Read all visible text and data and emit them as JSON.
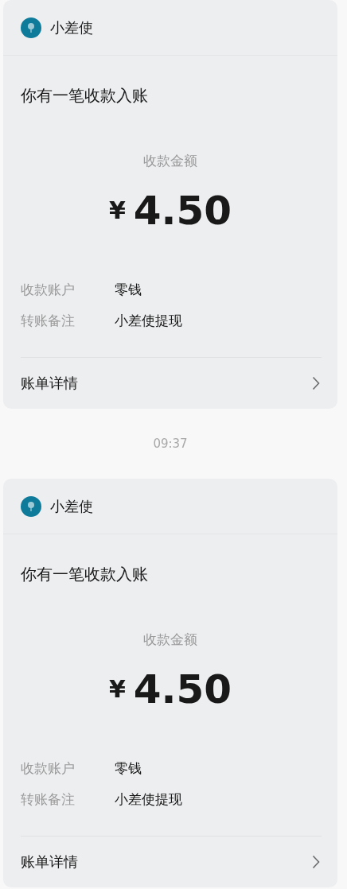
{
  "items": [
    {
      "kind": "card",
      "sender": "小差使",
      "title": "你有一笔收款入账",
      "amount_label": "收款金额",
      "currency": "¥",
      "amount": "4.50",
      "rows": [
        {
          "label": "收款账户",
          "value": "零钱"
        },
        {
          "label": "转账备注",
          "value": "小差使提现"
        }
      ],
      "footer_link": "账单详情"
    },
    {
      "kind": "time",
      "text": "09:37"
    },
    {
      "kind": "card",
      "sender": "小差使",
      "title": "你有一笔收款入账",
      "amount_label": "收款金额",
      "currency": "¥",
      "amount": "4.50",
      "rows": [
        {
          "label": "收款账户",
          "value": "零钱"
        },
        {
          "label": "转账备注",
          "value": "小差使提现"
        }
      ],
      "footer_link": "账单详情"
    }
  ]
}
